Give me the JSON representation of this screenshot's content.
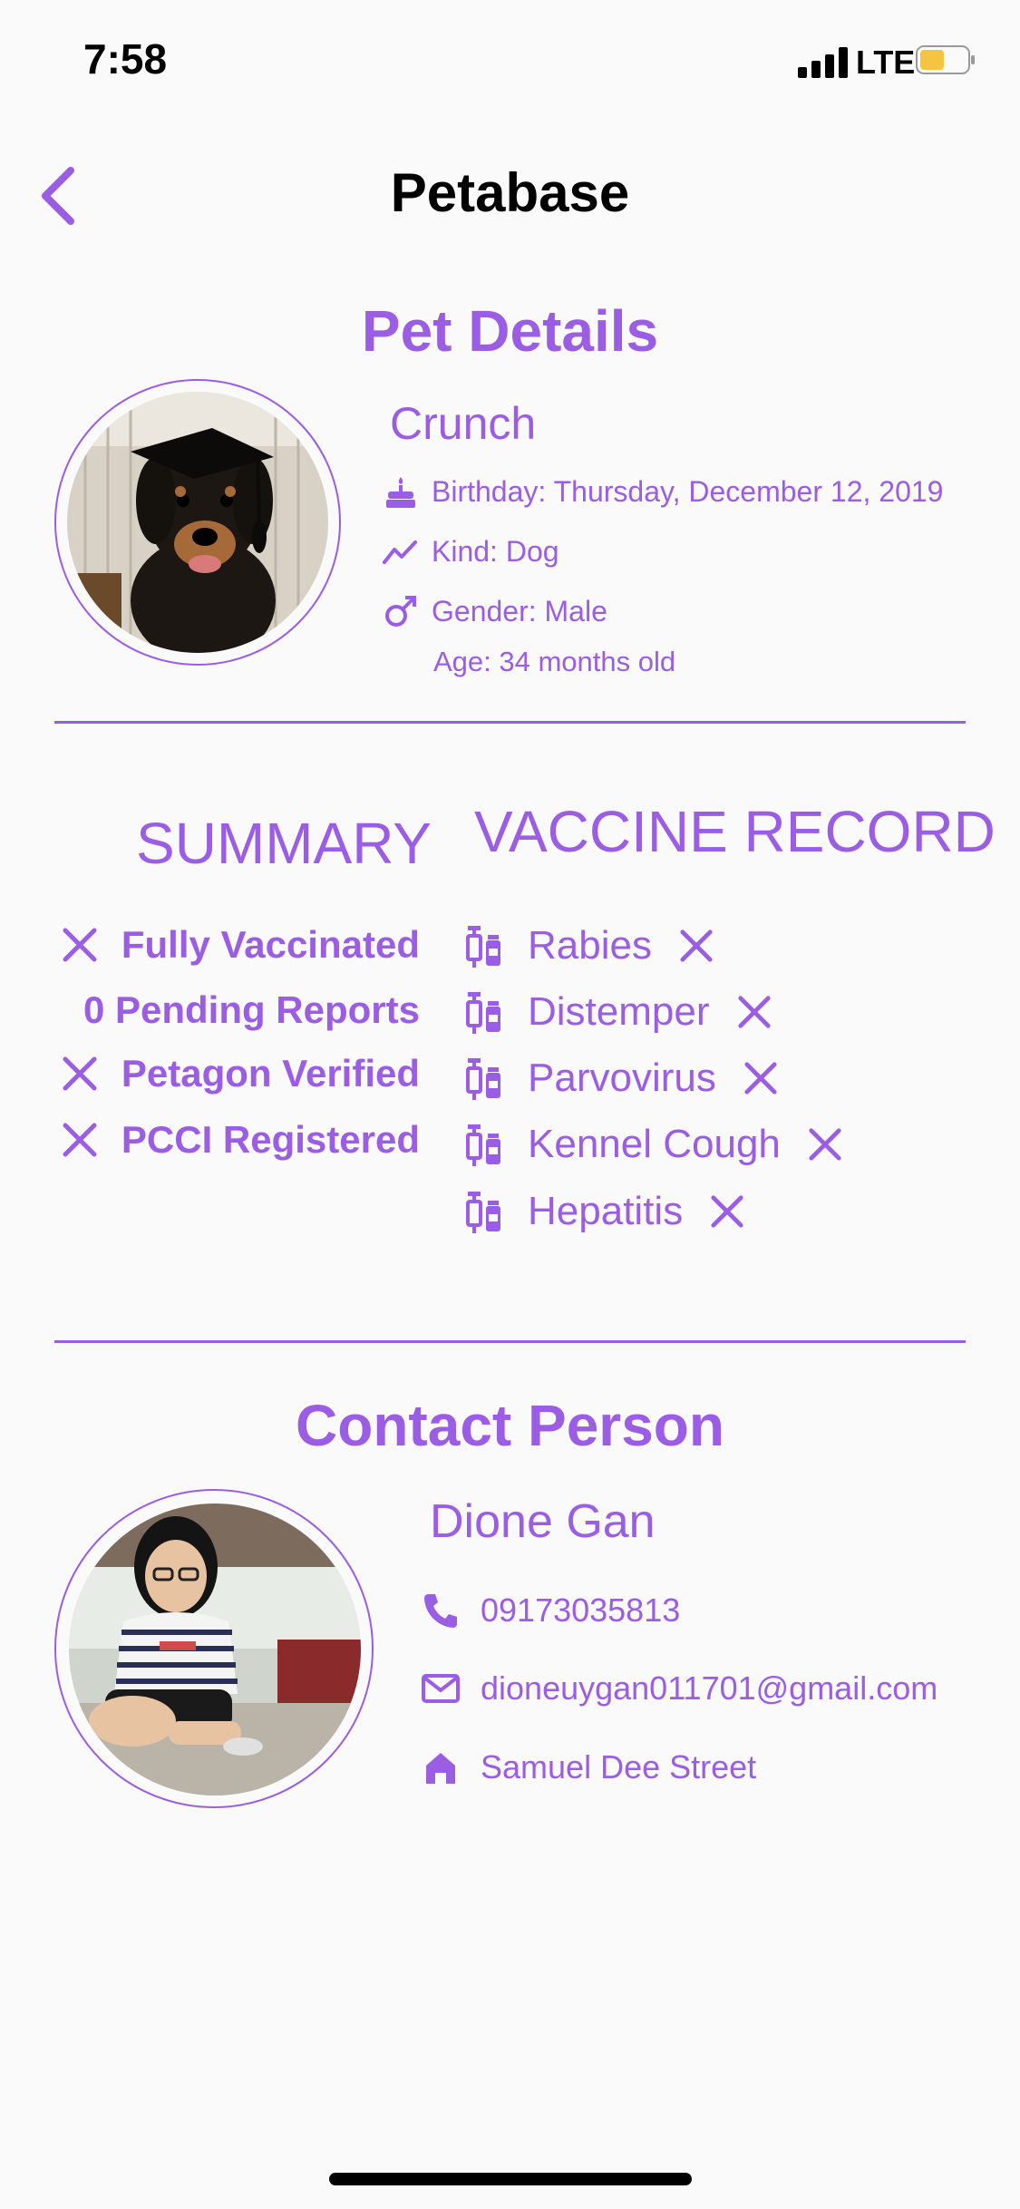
{
  "status_bar": {
    "time": "7:58",
    "network": "LTE"
  },
  "nav": {
    "title": "Petabase"
  },
  "pet": {
    "section_title": "Pet Details",
    "name": "Crunch",
    "birthday": "Birthday: Thursday, December 12, 2019",
    "kind": "Kind: Dog",
    "gender": "Gender: Male",
    "age": "Age: 34 months old"
  },
  "summary": {
    "title": "SUMMARY",
    "items": [
      {
        "label": "Fully Vaccinated",
        "icon": "close-icon"
      },
      {
        "label": "0 Pending Reports",
        "icon": ""
      },
      {
        "label": "Petagon Verified",
        "icon": "close-icon"
      },
      {
        "label": "PCCI Registered",
        "icon": "close-icon"
      }
    ]
  },
  "vaccine_record": {
    "title": "VACCINE RECORD",
    "items": [
      {
        "label": "Rabies",
        "status": "close-icon"
      },
      {
        "label": "Distemper",
        "status": "close-icon"
      },
      {
        "label": "Parvovirus",
        "status": "close-icon"
      },
      {
        "label": "Kennel Cough",
        "status": "close-icon"
      },
      {
        "label": "Hepatitis",
        "status": "close-icon"
      }
    ]
  },
  "contact": {
    "section_title": "Contact Person",
    "name": "Dione Gan",
    "phone": "09173035813",
    "email": "dioneuygan011701@gmail.com",
    "address": "Samuel Dee Street"
  },
  "colors": {
    "accent": "#9a5de3",
    "background": "#fafafa",
    "battery": "#f5c542"
  }
}
